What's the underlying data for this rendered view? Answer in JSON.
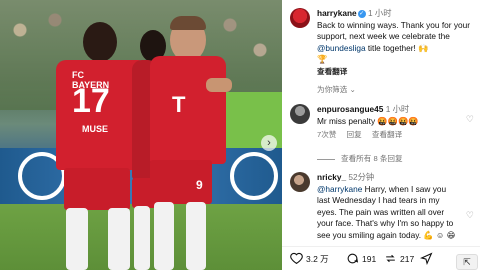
{
  "post_image": {
    "shirt_left_name": "FC BAYERN",
    "shirt_left_number": "17",
    "shirt_left_surname": "MUSE",
    "shirt_right_number": "9",
    "nav_arrow_icon": "chevron-right-icon"
  },
  "caption": {
    "username": "harrykane",
    "verified_mark": "✓",
    "time": "1 小时",
    "text_before_link": "Back to winning ways. Thank you for your support, next week we celebrate the ",
    "mention": "@bundesliga",
    "text_after_link": " title together! 🙌",
    "extra_emoji": "🏆",
    "translate": "查看翻译",
    "filter": "为你筛选"
  },
  "comments": [
    {
      "username": "enpurosangue45",
      "time": "1 小时",
      "text": "Mr miss penalty 🤬🤬🤬🤬",
      "likes": "7次赞",
      "reply": "回复",
      "translate": "查看翻译",
      "view_replies": "查看所有 8 条回复"
    },
    {
      "username": "nricky_",
      "time": "52分钟",
      "mention": "@harrykane",
      "text": " Harry, when I saw you last Wednesday I had tears in my eyes. The pain was written all over your face. That's why I'm so happy to see you smiling again today. 💪 ☺ 😄"
    }
  ],
  "actions": {
    "likes": "3.2 万",
    "comments": "191",
    "shares": "217"
  },
  "colors": {
    "link": "#00376b",
    "verified": "#3897f0",
    "muted": "#737373",
    "jersey_red": "#d2202e"
  }
}
